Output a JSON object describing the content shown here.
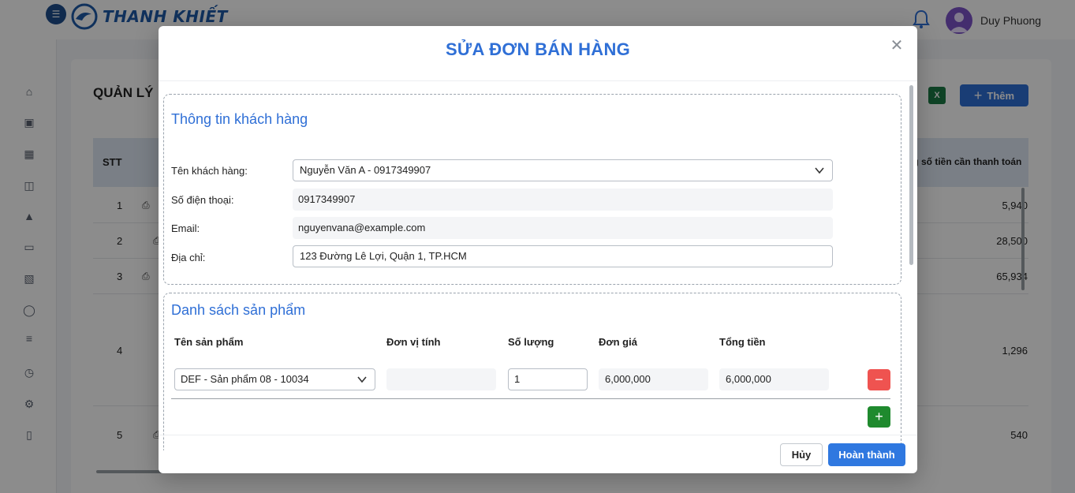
{
  "app": {
    "brand": "THANH KHIẾT",
    "user_name": "Duy Phuong"
  },
  "page": {
    "title": "QUẢN LÝ",
    "add_label": "Thêm",
    "excel_icon": "excel-icon"
  },
  "table": {
    "header_stt": "STT",
    "header_total": "ng số tiền cần thanh toán",
    "rows": [
      {
        "stt": "1",
        "value": "5,940"
      },
      {
        "stt": "2",
        "value": "28,500"
      },
      {
        "stt": "3",
        "value": "65,934"
      },
      {
        "stt": "4",
        "value": "1,296"
      },
      {
        "stt": "5",
        "value": "540"
      }
    ]
  },
  "modal": {
    "title": "SỬA ĐƠN BÁN HÀNG",
    "customer_section": {
      "title": "Thông tin khách hàng",
      "name_label": "Tên khách hàng:",
      "name_value": "Nguyễn Văn A - 0917349907",
      "phone_label": "Số điện thoại:",
      "phone_value": "0917349907",
      "email_label": "Email:",
      "email_value": "nguyenvana@example.com",
      "address_label": "Địa chỉ:",
      "address_value": "123 Đường Lê Lợi, Quận 1, TP.HCM"
    },
    "product_section": {
      "title": "Danh sách sản phẩm",
      "columns": {
        "product": "Tên sản phẩm",
        "unit": "Đơn vị tính",
        "quantity": "Số lượng",
        "price": "Đơn giá",
        "total": "Tổng tiền"
      },
      "items": [
        {
          "product": "DEF - Sản phẩm 08 - 10034",
          "unit": "",
          "quantity": "1",
          "price": "6,000,000",
          "total": "6,000,000"
        }
      ],
      "remove_icon": "minus-icon",
      "add_icon": "plus-icon"
    },
    "cancel_label": "Hủy",
    "done_label": "Hoàn thành"
  },
  "colors": {
    "accent": "#2f6fd6",
    "danger": "#ef5350",
    "success": "#1f8a2e"
  }
}
